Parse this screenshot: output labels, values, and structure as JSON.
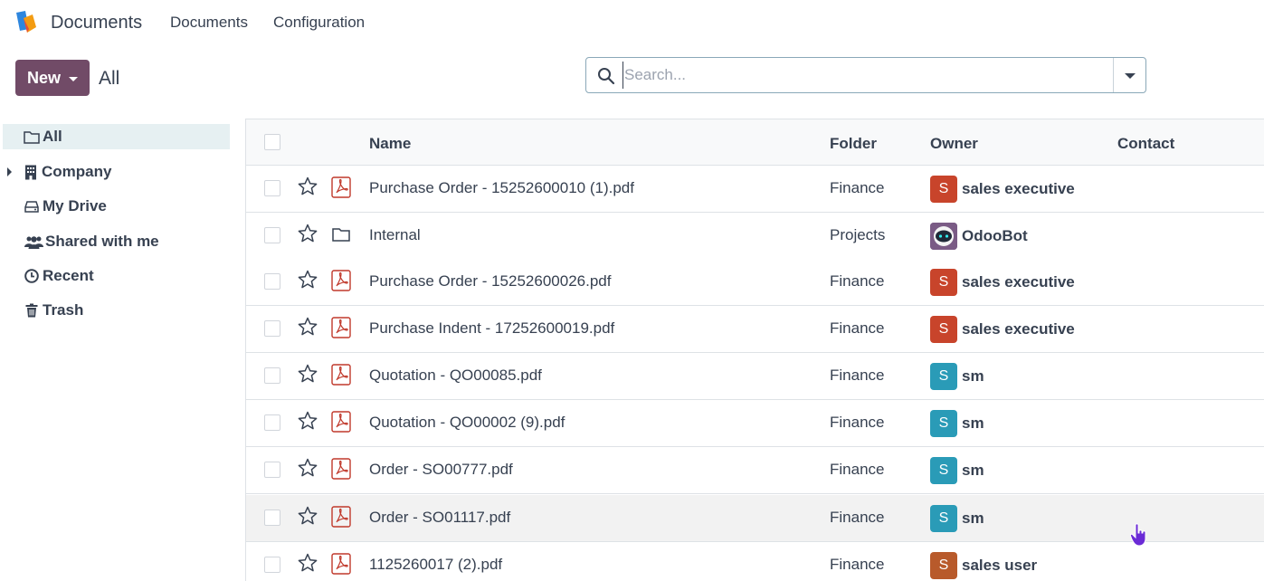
{
  "app": {
    "name": "Documents"
  },
  "menu": {
    "items": [
      "Documents",
      "Configuration"
    ]
  },
  "control": {
    "new_label": "New",
    "breadcrumb": "All"
  },
  "search": {
    "placeholder": "Search..."
  },
  "sidebar": {
    "items": [
      {
        "label": "All",
        "icon": "folder-open-icon",
        "active": true
      },
      {
        "label": "Company",
        "icon": "building-icon",
        "expandable": true
      },
      {
        "label": "My Drive",
        "icon": "hard-drive-icon"
      },
      {
        "label": "Shared with me",
        "icon": "users-icon"
      },
      {
        "label": "Recent",
        "icon": "clock-icon"
      },
      {
        "label": "Trash",
        "icon": "trash-icon"
      }
    ]
  },
  "table": {
    "headers": {
      "name": "Name",
      "folder": "Folder",
      "owner": "Owner",
      "contact": "Contact"
    },
    "rows": [
      {
        "name": "Purchase Order - 15252600010 (1).pdf",
        "type": "pdf",
        "folder": "Finance",
        "owner": "sales executive",
        "avatar": "S",
        "avatar_color": "#C8442B"
      },
      {
        "name": "Internal",
        "type": "folder",
        "folder": "Projects",
        "owner": "OdooBot",
        "avatar": "bot",
        "avatar_color": "#6d4a7a"
      },
      {
        "name": "Purchase Order - 15252600026.pdf",
        "type": "pdf",
        "folder": "Finance",
        "owner": "sales executive",
        "avatar": "S",
        "avatar_color": "#C8442B"
      },
      {
        "name": "Purchase Indent - 17252600019.pdf",
        "type": "pdf",
        "folder": "Finance",
        "owner": "sales executive",
        "avatar": "S",
        "avatar_color": "#C8442B"
      },
      {
        "name": "Quotation - QO00085.pdf",
        "type": "pdf",
        "folder": "Finance",
        "owner": "sm",
        "avatar": "S",
        "avatar_color": "#2A9BB7"
      },
      {
        "name": "Quotation - QO00002 (9).pdf",
        "type": "pdf",
        "folder": "Finance",
        "owner": "sm",
        "avatar": "S",
        "avatar_color": "#2A9BB7"
      },
      {
        "name": "Order - SO00777.pdf",
        "type": "pdf",
        "folder": "Finance",
        "owner": "sm",
        "avatar": "S",
        "avatar_color": "#2A9BB7"
      },
      {
        "name": "Order - SO01117.pdf",
        "type": "pdf",
        "folder": "Finance",
        "owner": "sm",
        "avatar": "S",
        "avatar_color": "#2A9BB7",
        "hover": true
      },
      {
        "name": "1125260017 (2).pdf",
        "type": "pdf",
        "folder": "Finance",
        "owner": "sales user",
        "avatar": "S",
        "avatar_color": "#B85A2B"
      }
    ]
  },
  "colors": {
    "primary": "#714B67",
    "active_bg": "#e6f0f2",
    "pdf": "#C0392B"
  }
}
